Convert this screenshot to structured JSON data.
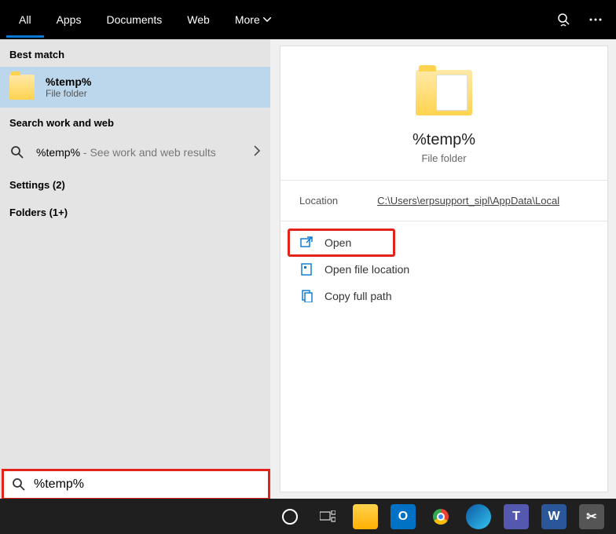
{
  "tabs": [
    "All",
    "Apps",
    "Documents",
    "Web",
    "More"
  ],
  "sections": {
    "best_match": "Best match",
    "search_work_web": "Search work and web",
    "settings": "Settings (2)",
    "folders": "Folders (1+)"
  },
  "best_match_item": {
    "title": "%temp%",
    "subtitle": "File folder"
  },
  "web_result": {
    "term": "%temp%",
    "suffix": " - See work and web results"
  },
  "preview": {
    "title": "%temp%",
    "subtitle": "File folder",
    "location_label": "Location",
    "location_value": "C:\\Users\\erpsupport_sipl\\AppData\\Local"
  },
  "actions": {
    "open": "Open",
    "open_location": "Open file location",
    "copy_path": "Copy full path"
  },
  "search_input": "%temp%"
}
